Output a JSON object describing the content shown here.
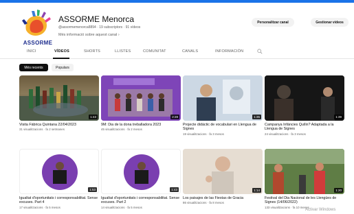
{
  "channel": {
    "name": "ASSORME Menorca",
    "meta": "@assormemenorca8894 · 19 subscriptors · 91 vídeos",
    "more_info": "Més informació sobre aquest canal",
    "logo_text": "ASSORME"
  },
  "actions": {
    "customize": "Personalitzar canal",
    "manage": "Gestionar vídeos"
  },
  "tabs": [
    {
      "label": "INICI",
      "active": false
    },
    {
      "label": "VÍDEOS",
      "active": true
    },
    {
      "label": "SHORTS",
      "active": false
    },
    {
      "label": "LLISTES",
      "active": false
    },
    {
      "label": "COMUNITAT",
      "active": false
    },
    {
      "label": "CANALS",
      "active": false
    },
    {
      "label": "INFORMACIÓN",
      "active": false
    }
  ],
  "filters": {
    "recent": "Més recents",
    "popular": "Populars"
  },
  "videos": [
    {
      "title": "Visita Fàbrica Quintana 22/04/2023",
      "meta": "31 visualitzacions · fa 2 setmanes",
      "duration": "1:43"
    },
    {
      "title": "9M: Dia de la dona treballadora 2023",
      "meta": "45 visualitzacions · fa 2 mesos",
      "duration": "2:28"
    },
    {
      "title": "Projecte didàctic de vocabulari en Llengua de Signes",
      "meta": "19 visualitzacions · fa 3 mesos",
      "duration": "1:35"
    },
    {
      "title": "Campanya Infàncies Quïlin? Adaptada a la Llengua de Signes",
      "meta": "24 visualitzacions · fa 3 mesos",
      "duration": "1:39"
    },
    {
      "title": "Igualtat d'oportunitats i corresponsabilitat. Sense excuses. Part 4",
      "meta": "17 visualitzacions · fa 5 mesos",
      "duration": "1:53"
    },
    {
      "title": "Igualtat d'oportunitats i corresponsabilitat. Sense excuses. Part 2",
      "meta": "14 visualitzacions · fa 5 mesos",
      "duration": "1:43"
    },
    {
      "title": "Los paisajes de las Fiestas de Gracia",
      "meta": "86 visualitzacions · fa 8 mesos",
      "duration": "1:14"
    },
    {
      "title": "Festival del Dia Nacional de les Llengües de Signes (14/06/2022)",
      "meta": "133 visualitzacions · fa 10 mesos",
      "duration": "1:20"
    }
  ],
  "watermark": "Activar Windows",
  "colors": {
    "accent_line": "#1a73e8",
    "chip_active": "#0f0f0f",
    "logo_orange": "#f28c28",
    "logo_blue": "#1f2f8f"
  }
}
